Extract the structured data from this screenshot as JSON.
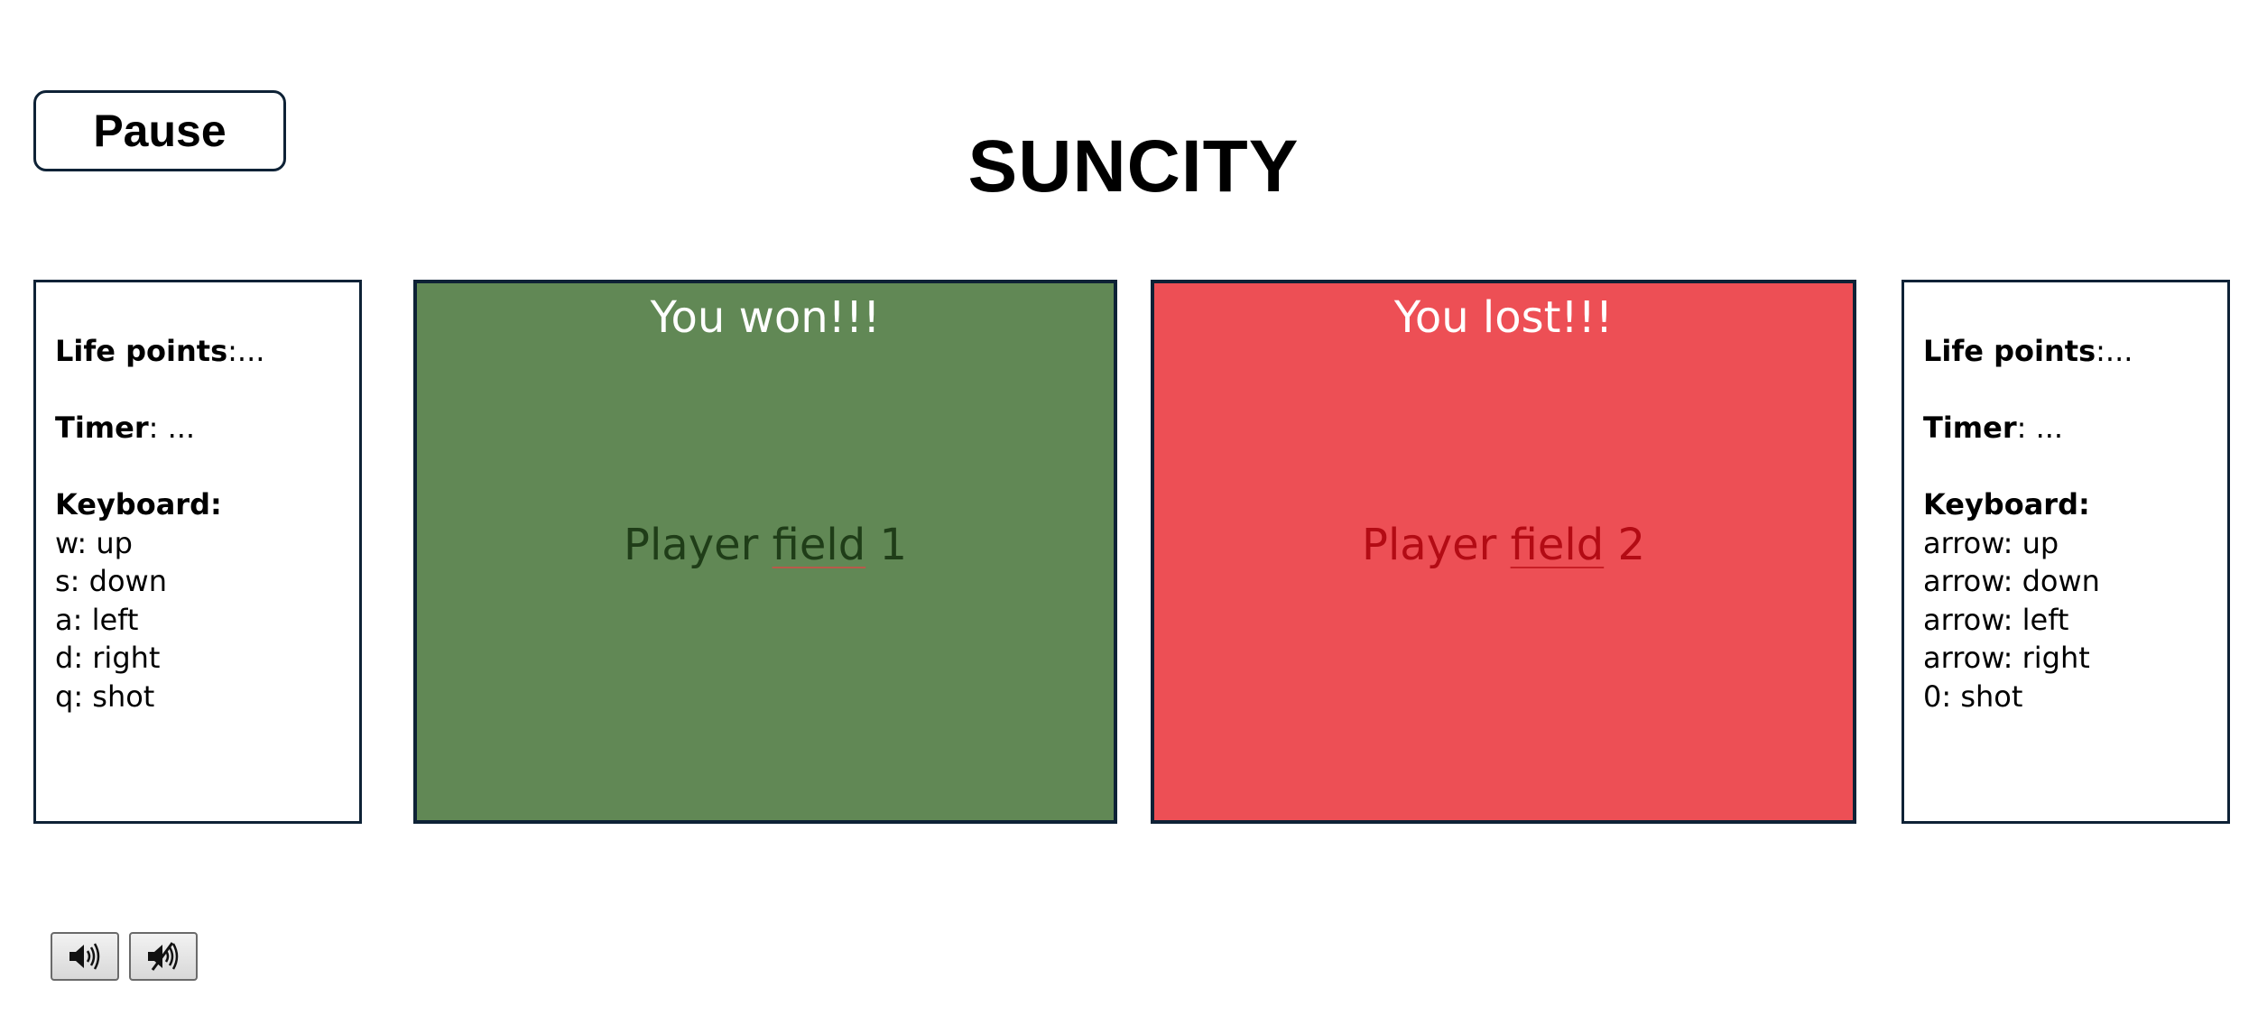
{
  "header": {
    "pause_label": "Pause",
    "title": "SUNCITY"
  },
  "player1": {
    "info": {
      "life_label": "Life points",
      "life_value": ":...",
      "timer_label": "Timer",
      "timer_value": ": ...",
      "keyboard_label": "Keyboard:",
      "keys": [
        "w: up",
        "s: down",
        "a: left",
        "d: right",
        "q: shot"
      ]
    },
    "field": {
      "result": "You won!!!",
      "label_prefix": "Player ",
      "label_underlined": "field",
      "label_suffix": " 1",
      "background": "#618855"
    }
  },
  "player2": {
    "info": {
      "life_label": "Life points",
      "life_value": ":...",
      "timer_label": "Timer",
      "timer_value": ": ...",
      "keyboard_label": "Keyboard:",
      "keys": [
        "arrow: up",
        "arrow: down",
        "arrow: left",
        "arrow: right",
        "0: shot"
      ]
    },
    "field": {
      "result": "You lost!!!",
      "label_prefix": "Player ",
      "label_underlined": "field",
      "label_suffix": " 2",
      "background": "#ed4f55"
    }
  },
  "sound": {
    "on_icon": "speaker-on-icon",
    "off_icon": "speaker-off-icon"
  }
}
